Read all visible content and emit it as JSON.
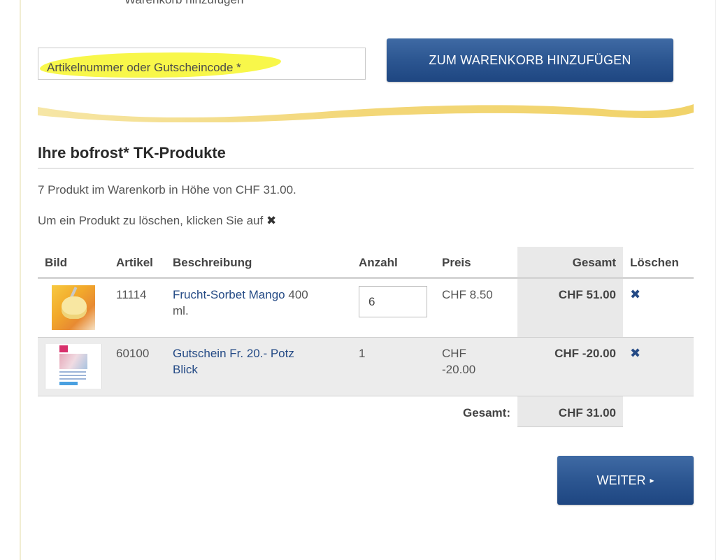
{
  "top_cut_text": "Warenkorb hinzufügen",
  "code_input": {
    "placeholder": "Artikelnummer oder Gutscheincode *"
  },
  "add_button": "ZUM WARENKORB HINZUFÜGEN",
  "section_title": "Ihre bofrost* TK-Produkte",
  "summary_text": "7 Produkt im Warenkorb in Höhe von CHF 31.00.",
  "delete_hint": "Um ein Produkt zu löschen, klicken Sie auf",
  "delete_symbol": "✖",
  "table": {
    "headers": {
      "bild": "Bild",
      "artikel": "Artikel",
      "beschreibung": "Beschreibung",
      "anzahl": "Anzahl",
      "preis": "Preis",
      "gesamt": "Gesamt",
      "loeschen": "Löschen"
    },
    "rows": [
      {
        "artikel": "11114",
        "beschreibung_link": "Frucht-Sorbet Mango",
        "beschreibung_rest": "400",
        "beschreibung_line2": "ml.",
        "anzahl": "6",
        "preis": "CHF 8.50",
        "gesamt": "CHF 51.00",
        "image_icon": "mango-sorbet-image"
      },
      {
        "artikel": "60100",
        "beschreibung_link": "Gutschein Fr. 20.- Potz",
        "beschreibung_line2": "Blick",
        "anzahl": "1",
        "preis_line1": "CHF",
        "preis_line2": "-20.00",
        "gesamt": "CHF -20.00",
        "image_icon": "voucher-image"
      }
    ],
    "total_label": "Gesamt:",
    "total_value": "CHF 31.00"
  },
  "weiter_button": "WEITER",
  "weiter_arrow": "▸",
  "colors": {
    "primary_blue": "#2c5691",
    "link_blue": "#244a85",
    "highlight_yellow": "#f8f74a",
    "wave_gold": "#f1d36a"
  }
}
